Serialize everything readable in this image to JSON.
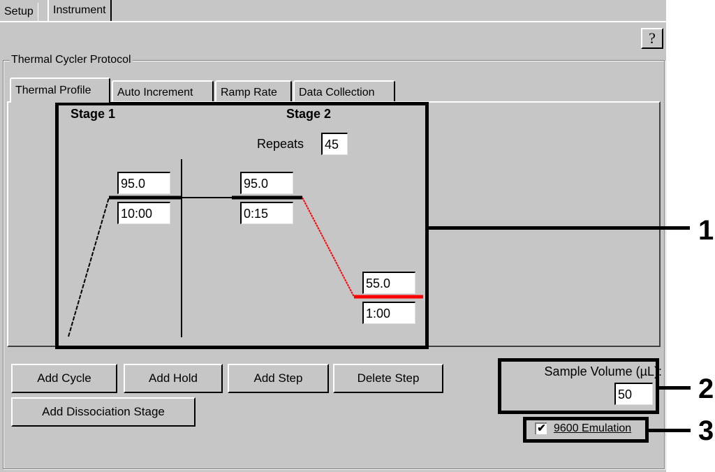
{
  "window_tabs": [
    {
      "label": "Setup",
      "active": false
    },
    {
      "label": "Instrument",
      "active": true
    }
  ],
  "help_button": {
    "label": "?"
  },
  "group": {
    "title": "Thermal Cycler Protocol"
  },
  "sub_tabs": [
    {
      "label": "Thermal Profile",
      "active": true
    },
    {
      "label": "Auto Increment",
      "active": false
    },
    {
      "label": "Ramp Rate",
      "active": false
    },
    {
      "label": "Data Collection",
      "active": false
    }
  ],
  "profile": {
    "stages": [
      {
        "label": "Stage 1",
        "steps": [
          {
            "temperature": "95.0",
            "time": "10:00"
          }
        ]
      },
      {
        "label": "Stage 2",
        "repeats_label": "Repeats",
        "repeats": "45",
        "steps": [
          {
            "temperature": "95.0",
            "time": "0:15"
          },
          {
            "temperature": "55.0",
            "time": "1:00"
          }
        ]
      }
    ],
    "line_color": "#000000",
    "selected_color": "#ff0000"
  },
  "buttons": {
    "add_cycle": "Add Cycle",
    "add_hold": "Add Hold",
    "add_step": "Add Step",
    "delete_step": "Delete Step",
    "add_dissociation": "Add Dissociation Stage"
  },
  "sample_volume": {
    "label": "Sample Volume (µL):",
    "value": "50"
  },
  "emulation": {
    "label": "9600 Emulation",
    "checked": true,
    "check_glyph": "✔"
  },
  "annotations": [
    "1",
    "2",
    "3"
  ]
}
